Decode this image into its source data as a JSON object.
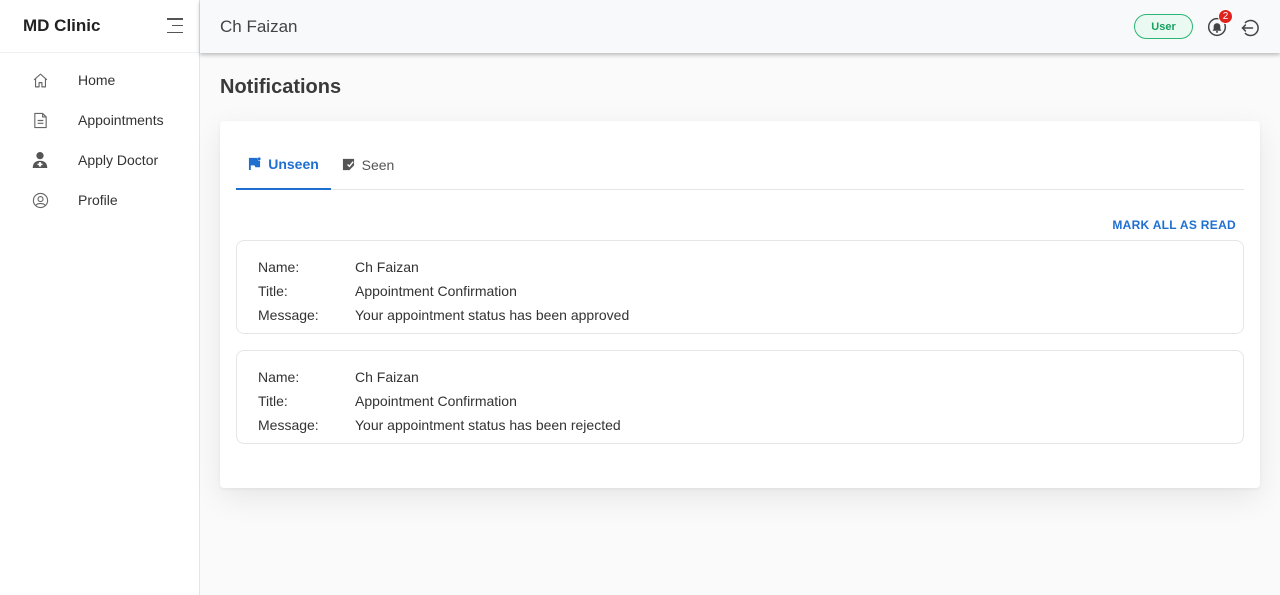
{
  "app": {
    "brand": "MD Clinic"
  },
  "sidebar": {
    "items": [
      {
        "label": "Home",
        "icon": "home-icon"
      },
      {
        "label": "Appointments",
        "icon": "document-icon"
      },
      {
        "label": "Apply Doctor",
        "icon": "doctor-icon"
      },
      {
        "label": "Profile",
        "icon": "user-circle-icon"
      }
    ]
  },
  "header": {
    "user_name": "Ch Faizan",
    "role": "User",
    "notification_count": "2"
  },
  "page": {
    "title": "Notifications"
  },
  "tabs": [
    {
      "label": "Unseen",
      "active": true
    },
    {
      "label": "Seen",
      "active": false
    }
  ],
  "actions": {
    "mark_all_label": "MARK ALL AS READ"
  },
  "notifications": [
    {
      "name_label": "Name:",
      "name": "Ch Faizan",
      "title_label": "Title:",
      "title": "Appointment Confirmation",
      "message_label": "Message:",
      "message": "Your appointment status has been approved"
    },
    {
      "name_label": "Name:",
      "name": "Ch Faizan",
      "title_label": "Title:",
      "title": "Appointment Confirmation",
      "message_label": "Message:",
      "message": "Your appointment status has been rejected"
    }
  ],
  "colors": {
    "accent": "#1f6fd1",
    "badge_green": "#2bb673",
    "notification_red": "#e0221c"
  }
}
